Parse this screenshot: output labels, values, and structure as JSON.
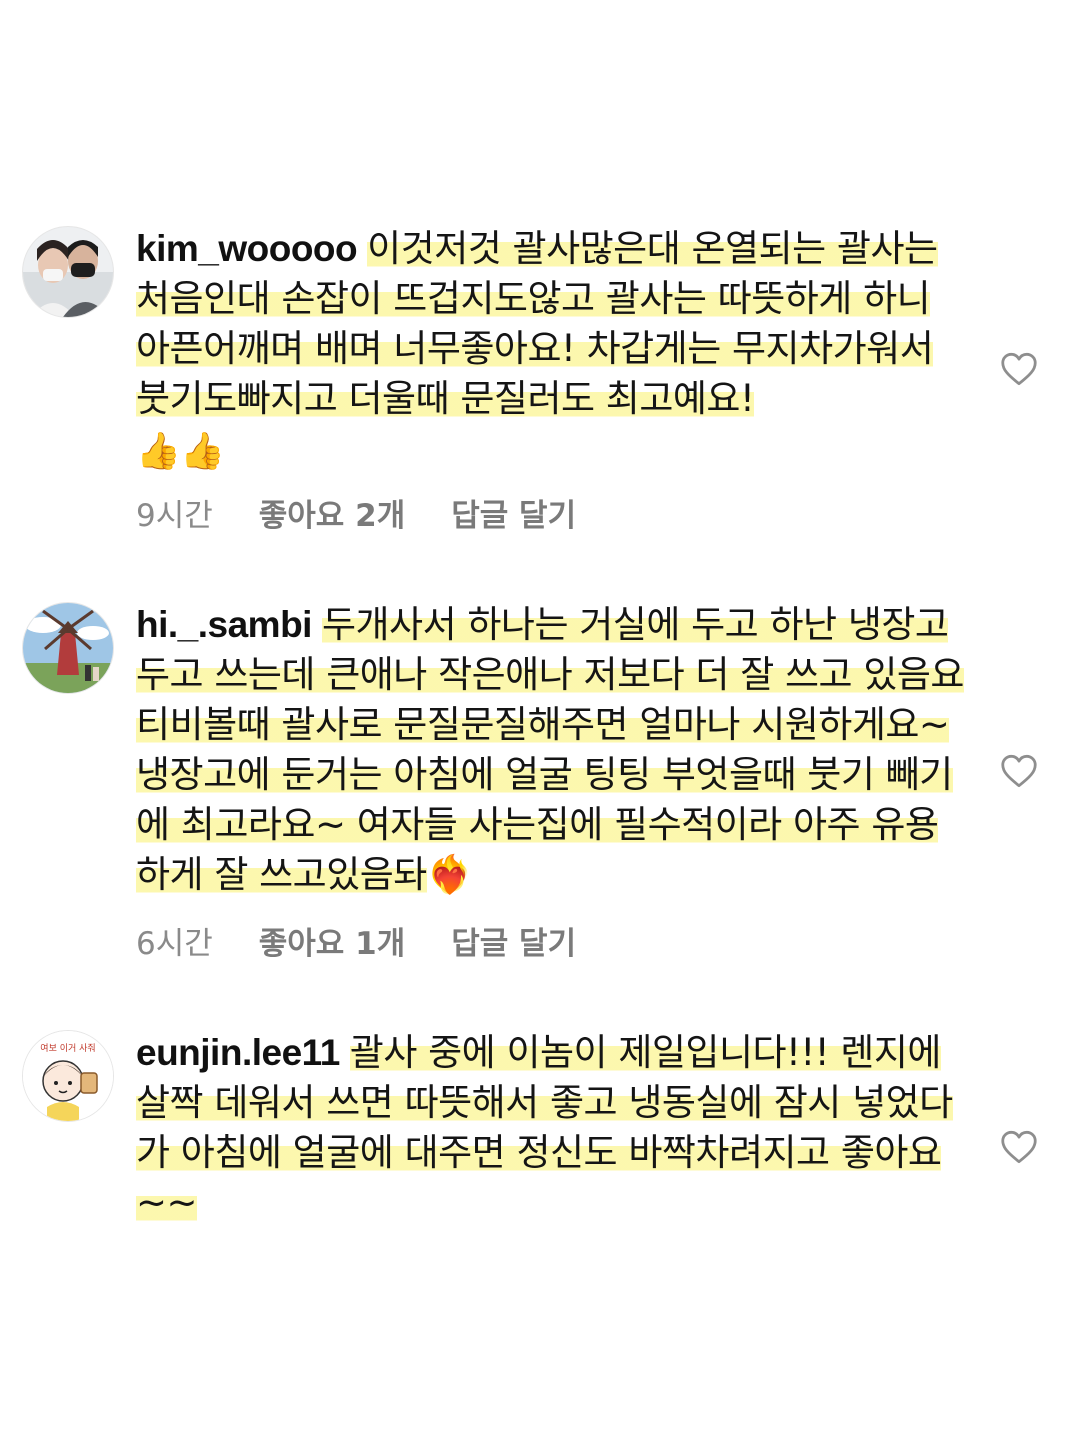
{
  "comments": [
    {
      "username": "kim_wooooo",
      "text": "이것저것 괄사많은대 온열되는 괄사는 처음인대 손잡이 뜨겁지도않고 괄사는 따뜻하게 하니 아픈어깨며 배며 너무좋아요! 차갑게는 무지차가워서 붓기도빠지고 더울때 문질러도 최고예요!",
      "emoji": "👍👍",
      "time": "9시간",
      "likes": "좋아요 2개",
      "reply": "답글 달기"
    },
    {
      "username": "hi._.sambi",
      "text": "두개사서 하나는 거실에 두고 하난 냉장고 두고 쓰는데 큰애나 작은애나 저보다 더 잘 쓰고 있음요 티비볼때 괄사로 문질문질해주면 얼마나 시원하게요~ 냉장고에 둔거는 아침에 얼굴 팅팅 부엇을때 붓기 빼기에 최고라요~ 여자들 사는집에 필수적이라 아주 유용하게 잘 쓰고있음돠",
      "emoji": "❤️‍🔥",
      "time": "6시간",
      "likes": "좋아요 1개",
      "reply": "답글 달기"
    },
    {
      "username": "eunjin.lee11",
      "text": "괄사 중에 이놈이 제일입니다!!! 렌지에 살짝 데워서 쓰면 따뜻해서 좋고 냉동실에 잠시 넣었다가 아침에 얼굴에 대주면 정신도 바짝차려지고 좋아요~~",
      "avatar_text": "여보 이거 사줘"
    }
  ],
  "icons": {
    "like": "heart-outline-icon",
    "avatar1": "couple-photo-avatar",
    "avatar2": "windmill-photo-avatar",
    "avatar3": "cartoon-character-avatar"
  },
  "colors": {
    "highlight": "#fcf6a0",
    "meta_text": "#8a8a8a",
    "heart_stroke": "#8e8e8e"
  }
}
